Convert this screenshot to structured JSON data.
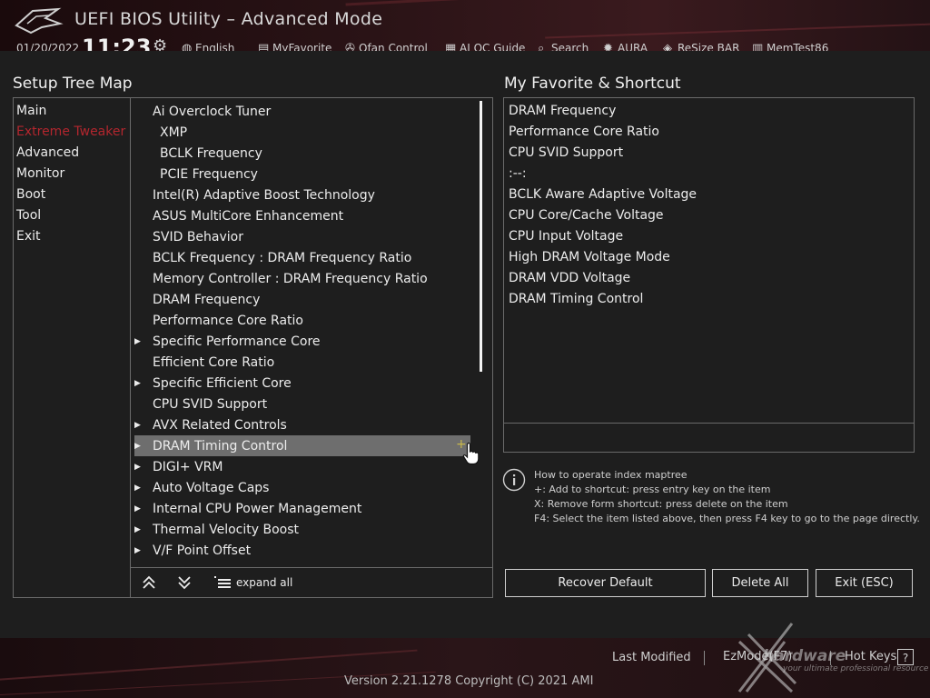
{
  "header": {
    "title": "UEFI BIOS Utility – Advanced Mode",
    "date": "01/20/2022",
    "time": "11:23",
    "items": [
      "English",
      "MyFavorite",
      "Qfan Control",
      "AI OC Guide",
      "Search",
      "AURA",
      "ReSize BAR",
      "MemTest86"
    ]
  },
  "tree": {
    "title": "Setup Tree Map",
    "categories": [
      "Main",
      "Extreme Tweaker",
      "Advanced",
      "Monitor",
      "Boot",
      "Tool",
      "Exit"
    ],
    "active_category": "Extreme Tweaker",
    "items": [
      {
        "label": "Ai Overclock Tuner",
        "arrow": false,
        "indent": 0
      },
      {
        "label": "XMP",
        "arrow": false,
        "indent": 1
      },
      {
        "label": "BCLK Frequency",
        "arrow": false,
        "indent": 1
      },
      {
        "label": "PCIE Frequency",
        "arrow": false,
        "indent": 1
      },
      {
        "label": "Intel(R) Adaptive Boost Technology",
        "arrow": false,
        "indent": 0
      },
      {
        "label": "ASUS MultiCore Enhancement",
        "arrow": false,
        "indent": 0
      },
      {
        "label": "SVID Behavior",
        "arrow": false,
        "indent": 0
      },
      {
        "label": "BCLK Frequency : DRAM Frequency Ratio",
        "arrow": false,
        "indent": 0
      },
      {
        "label": "Memory Controller : DRAM Frequency Ratio",
        "arrow": false,
        "indent": 0
      },
      {
        "label": "DRAM Frequency",
        "arrow": false,
        "indent": 0
      },
      {
        "label": "Performance Core Ratio",
        "arrow": false,
        "indent": 0
      },
      {
        "label": "Specific Performance Core",
        "arrow": true,
        "indent": 0
      },
      {
        "label": "Efficient Core Ratio",
        "arrow": false,
        "indent": 0
      },
      {
        "label": "Specific Efficient Core",
        "arrow": true,
        "indent": 0
      },
      {
        "label": "CPU SVID Support",
        "arrow": false,
        "indent": 0
      },
      {
        "label": "AVX Related Controls",
        "arrow": true,
        "indent": 0
      },
      {
        "label": "DRAM Timing Control",
        "arrow": true,
        "indent": 0,
        "selected": true
      },
      {
        "label": "DIGI+ VRM",
        "arrow": true,
        "indent": 0
      },
      {
        "label": "Auto Voltage Caps",
        "arrow": true,
        "indent": 0
      },
      {
        "label": "Internal CPU Power Management",
        "arrow": true,
        "indent": 0
      },
      {
        "label": "Thermal Velocity Boost",
        "arrow": true,
        "indent": 0
      },
      {
        "label": "V/F Point Offset",
        "arrow": true,
        "indent": 0
      }
    ],
    "selected_plus": "+",
    "expand_label": "expand all"
  },
  "favorites": {
    "title": "My Favorite & Shortcut",
    "items": [
      "DRAM Frequency",
      "Performance Core Ratio",
      "CPU SVID Support",
      ":--:",
      "BCLK Aware Adaptive Voltage",
      "CPU Core/Cache Voltage",
      "CPU Input Voltage",
      "High DRAM Voltage Mode",
      "DRAM VDD Voltage",
      "DRAM Timing Control"
    ]
  },
  "help": {
    "lines": [
      "How to operate index maptree",
      "+: Add to shortcut: press entry key on the item",
      "X: Remove form shortcut: press delete on the item",
      "F4: Select the item listed above, then press F4 key to go to the page directly."
    ]
  },
  "buttons": {
    "recover": "Recover Default",
    "delete_all": "Delete All",
    "exit": "Exit (ESC)"
  },
  "footer": {
    "last_modified": "Last Modified",
    "ez_mode": "EzMode(F7)",
    "hot_keys": "Hot Keys",
    "hot_keys_q": "?",
    "version": "Version 2.21.1278 Copyright (C) 2021 AMI"
  },
  "watermark": {
    "text": "hardware",
    "sub": "your ultimate professional resource"
  },
  "colors": {
    "active_category": "#b3262e",
    "highlight": "#6e6e6e",
    "plus": "#c8b84a"
  }
}
